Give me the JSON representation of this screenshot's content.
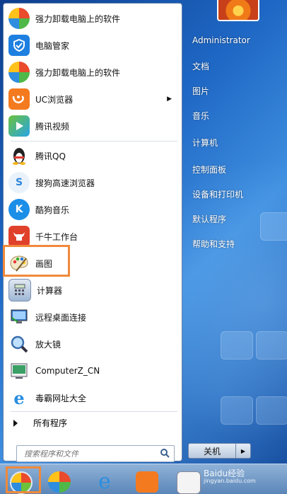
{
  "start_menu": {
    "items": [
      {
        "label": "强力卸载电脑上的软件",
        "icon": "pinwheel-icon",
        "color": "#4fb848"
      },
      {
        "label": "电脑管家",
        "icon": "shield-check-icon",
        "color": "#1d7fe0"
      },
      {
        "label": "强力卸载电脑上的软件",
        "icon": "pinwheel-icon",
        "color": "#4fb848"
      },
      {
        "label": "UC浏览器",
        "icon": "uc-browser-icon",
        "color": "#f47a1f",
        "submenu": true
      },
      {
        "label": "腾讯视频",
        "icon": "play-icon",
        "color": "#27a5e6"
      },
      {
        "label": "腾讯QQ",
        "icon": "penguin-icon",
        "color": "#222222"
      },
      {
        "label": "搜狗高速浏览器",
        "icon": "sogou-browser-icon",
        "color": "#2d86db"
      },
      {
        "label": "酷狗音乐",
        "icon": "kugou-icon",
        "color": "#1b8ee8"
      },
      {
        "label": "千牛工作台",
        "icon": "bull-icon",
        "color": "#e0412b"
      },
      {
        "label": "画图",
        "icon": "paint-palette-icon",
        "color": "#6aa0d8"
      },
      {
        "label": "计算器",
        "icon": "calculator-icon",
        "color": "#7fa6d1"
      },
      {
        "label": "远程桌面连接",
        "icon": "remote-desktop-icon",
        "color": "#3a7bc8"
      },
      {
        "label": "放大镜",
        "icon": "magnifier-icon",
        "color": "#6d98c9"
      },
      {
        "label": "ComputerZ_CN",
        "icon": "computerz-icon",
        "color": "#3aa066"
      },
      {
        "label": "毒霸网址大全",
        "icon": "ie-icon",
        "color": "#2a8fe0"
      }
    ],
    "all_programs": "所有程序",
    "search_placeholder": "搜索程序和文件"
  },
  "right_pane": {
    "items": [
      "Administrator",
      "文档",
      "图片",
      "音乐",
      "计算机",
      "控制面板",
      "设备和打印机",
      "默认程序",
      "帮助和支持"
    ],
    "shutdown_label": "关机"
  },
  "taskbar": {
    "watermark": "Baidu经验",
    "watermark_sub": "jingyan.baidu.com"
  },
  "colors": {
    "highlight": "#f0893a",
    "accent": "#1e67c4"
  }
}
